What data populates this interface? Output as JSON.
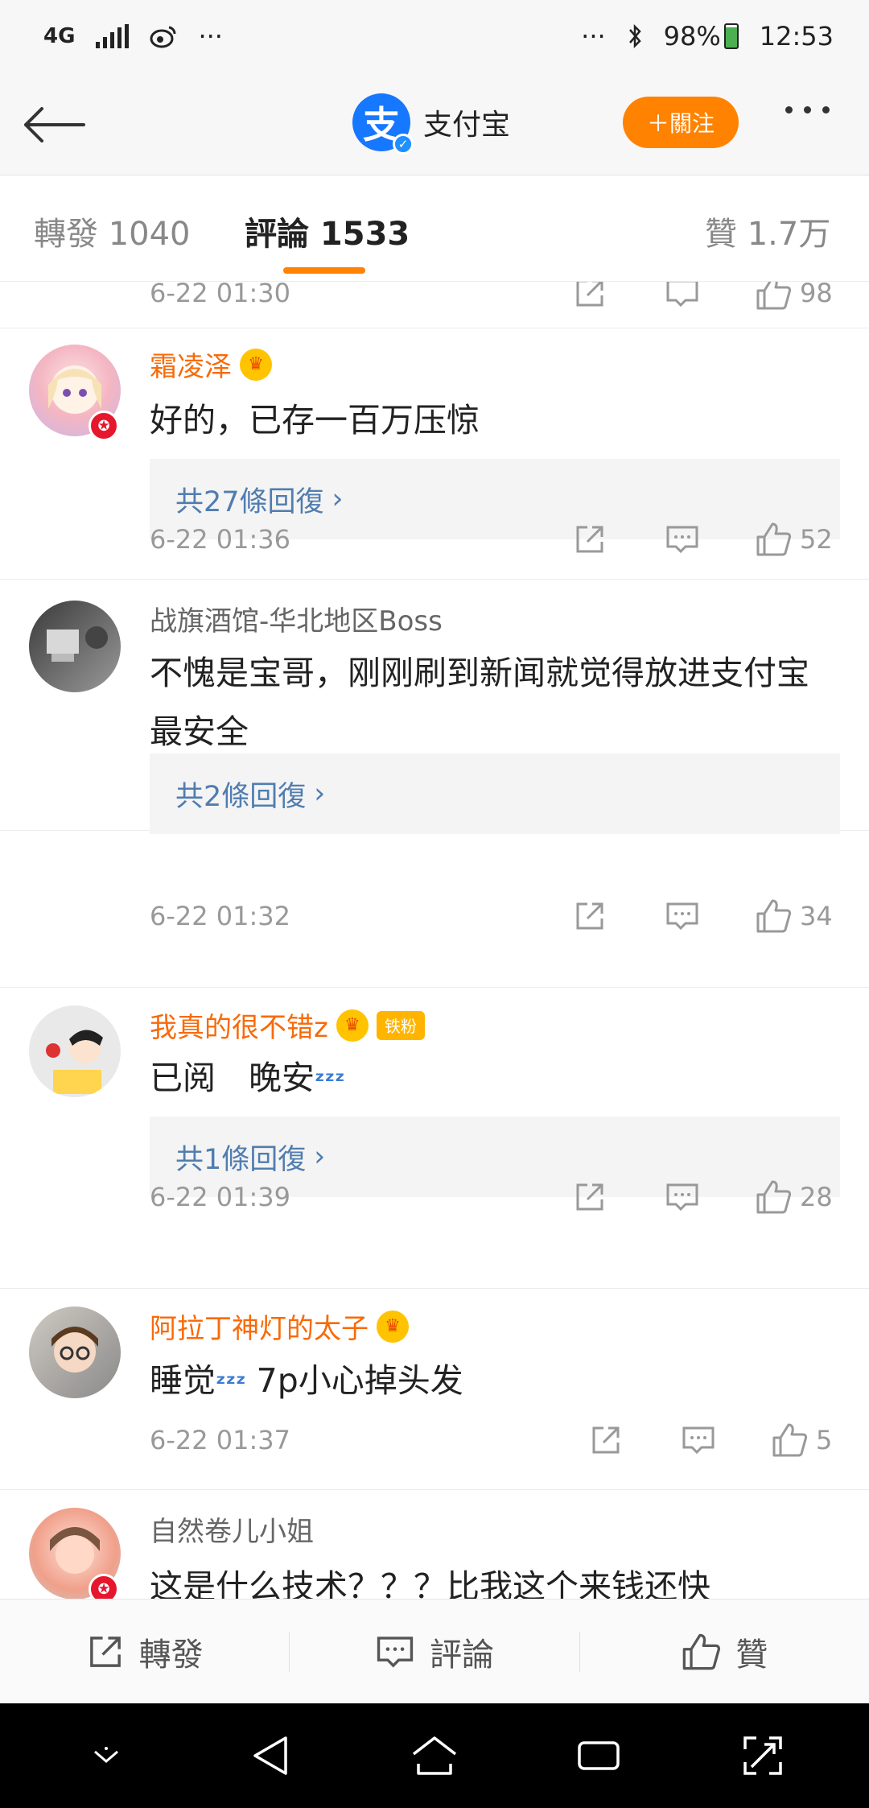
{
  "status_bar": {
    "network": "4G",
    "dots": "···",
    "battery": "98%",
    "time": "12:53"
  },
  "header": {
    "account_name": "支付宝",
    "logo_char": "支",
    "follow_label": "＋關注"
  },
  "tabs": [
    {
      "label": "轉發 1040"
    },
    {
      "label": "評論 1533"
    },
    {
      "label": "贊 1.7万"
    }
  ],
  "partial_top": {
    "timestamp": "6-22 01:30",
    "likes": "98"
  },
  "comments": [
    {
      "username": "霜凌泽",
      "text": "好的，已存一百万压惊",
      "replies": "共27條回復 ",
      "timestamp": "6-22 01:36",
      "likes": "52"
    },
    {
      "username": "战旗酒馆-华北地区Boss",
      "text": "不愧是宝哥，刚刚刷到新闻就觉得放进支付宝最安全",
      "replies": "共2條回復 ",
      "timestamp": "6-22 01:32",
      "likes": "34"
    },
    {
      "username": "我真的很不错z",
      "fan_badge": "铁粉",
      "text": "已阅　晚安",
      "replies": "共1條回復 ",
      "timestamp": "6-22 01:39",
      "likes": "28"
    },
    {
      "username": "阿拉丁神灯的太子",
      "text_a": "睡觉",
      "text_b": " 7p小心掉头发",
      "timestamp": "6-22 01:37",
      "likes": "5"
    },
    {
      "username": "自然卷儿小姐",
      "text": "这是什么技术？？？比我这个来钱还快"
    }
  ],
  "bottom_bar": {
    "repost_label": "轉發",
    "comment_label": "評論",
    "like_label": "贊"
  },
  "colors": {
    "accent_orange": "#ff8200",
    "vip_name": "#f86a09",
    "link_blue": "#507daf"
  }
}
